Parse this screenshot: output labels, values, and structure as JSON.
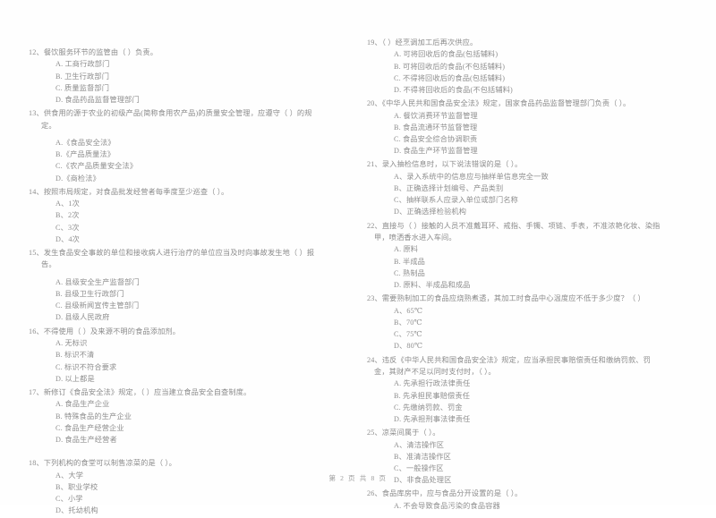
{
  "document": {
    "kind": "scanned-exam-page",
    "language": "zh-CN",
    "footer": "第 2 页 共 8 页"
  },
  "left_column": {
    "questions": [
      {
        "number": "12、",
        "stem": "餐饮服务环节的监管由（      ）负责。",
        "options": [
          "A. 工商行政部门",
          "B. 卫生行政部门",
          "C. 质量监督部门",
          "D. 食品药品监督管理部门"
        ]
      },
      {
        "number": "13、",
        "stem": "供食用的源于农业的初级产品(简称食用农产品)的质量安全管理，应遵守（      ）的规定。",
        "options": [
          "A.《食品安全法》",
          "B.《产品质量法》",
          "C.《农产品质量安全法》",
          "D.《商检法》"
        ]
      },
      {
        "number": "14、",
        "stem": "按照市局规定，对食品批发经营者每季度至少巡查（      ）。",
        "options": [
          "A、1次",
          "B、2次",
          "C、3次",
          "D、4次"
        ]
      },
      {
        "number": "15、",
        "stem": "发生食品安全事故的单位和接收病人进行治疗的单位应当及时向事故发生地（      ）报告。",
        "options": [
          "A. 县级安全生产监督部门",
          "B. 县级卫生行政部门",
          "C. 县级新闻宣传主管部门",
          "D. 县级人民政府"
        ]
      },
      {
        "number": "16、",
        "stem": "不得使用（      ）及来源不明的食品添加剂。",
        "options": [
          "A. 无标识",
          "B. 标识不清",
          "C. 标识不符合要求",
          "D. 以上都是"
        ]
      },
      {
        "number": "17、",
        "stem": "新修订《食品安全法》规定，（      ）应当建立食品安全自查制度。",
        "options": [
          "A. 食品生产企业",
          "B. 特殊食品的生产企业",
          "C. 食品生产经营企业",
          "D. 食品生产经营者"
        ]
      },
      {
        "number": "18、",
        "stem": "下列机构的食堂可以制售凉菜的是（      ）。",
        "options": [
          "A、大学",
          "B、职业学校",
          "C、小学",
          "D、托幼机构"
        ]
      }
    ]
  },
  "right_column": {
    "questions": [
      {
        "number": "19、",
        "stem": "（      ）经烹调加工后再次供应。",
        "options": [
          "A. 可将回收后的食品(包括辅料)",
          "B. 可将回收后的食品(不包括辅料)",
          "C. 不得将回收后的食品(包括辅料)",
          "D. 不得将回收后的食品(不包括辅料)"
        ]
      },
      {
        "number": "20、",
        "stem": "《中华人民共和国食品安全法》规定，国家食品药品监督管理部门负责（      ）。",
        "options": [
          "A. 餐饮消费环节监督管理",
          "B. 食品流通环节监督管理",
          "C. 食品安全综合协调职责",
          "D. 食品生产环节监督管理"
        ]
      },
      {
        "number": "21、",
        "stem": "录入抽检信息时，以下说法错误的是（      ）。",
        "options": [
          "A、录入系统中的信息应与抽样单信息完全一致",
          "B、正确选择计划编号、产品类别",
          "C、抽样联系人应录入单位或部门名称",
          "D、正确选择检验机构"
        ]
      },
      {
        "number": "22、",
        "stem": "直接与（      ）接触的人员不准戴耳环、戒指、手镯、项链、手表，不准浓艳化妆、染指甲，喷洒香水进入车间。",
        "options": [
          "A. 原料",
          "B. 半成品",
          "C. 熟制品",
          "D. 原料、半成品和成品"
        ]
      },
      {
        "number": "23、",
        "stem": "需要熟制加工的食品应烧熟煮透，其加工时食品中心温度应不低于多少度？（      ）",
        "options": [
          "A、65℃",
          "B、70℃",
          "C、75℃",
          "D、80℃"
        ]
      },
      {
        "number": "24、",
        "stem": "违反《中华人民共和国食品安全法》规定，应当承担民事赔偿责任和缴纳罚款、罚金，其财产不足以同时支付时，（      ）。",
        "options": [
          "A. 先承担行政法律责任",
          "B. 先承担民事赔偿责任",
          "C. 先缴纳罚款、罚金",
          "D. 先承担刑事法律责任"
        ]
      },
      {
        "number": "25、",
        "stem": "凉菜间属于（      ）。",
        "options": [
          "A、清洁操作区",
          "B、准清洁操作区",
          "C、一般操作区",
          "D、非食品处理区"
        ]
      },
      {
        "number": "26、",
        "stem": "食品库房中，应与食品分开设置的是（      ）。",
        "options": [
          "A. 不会导致食品污染的食品容器"
        ]
      }
    ]
  }
}
